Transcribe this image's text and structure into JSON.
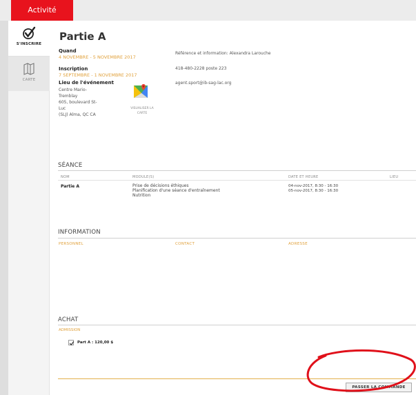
{
  "tabs": {
    "activite": "Activité"
  },
  "sidenav": {
    "inscrire": "S'INSCRIRE",
    "carte": "CARTE"
  },
  "event": {
    "title": "Partie A",
    "quand_label": "Quand",
    "quand_value": "4 NOVEMBRE - 5 NOVEMBRE 2017",
    "inscription_label": "Inscription",
    "inscription_value": "7 SEPTEMBRE - 1 NOVEMBRE 2017",
    "lieu_label": "Lieu de l'événement",
    "lieu_lines": [
      "Centre Mario-",
      "Tremblay",
      "605, boulevard St-",
      "Luc",
      "(SLJ) Alma, QC CA"
    ],
    "map_caption": "VISUALISER LA CARTE",
    "reference": "Référence et information: Alexandra Larouche",
    "phone": "418-480-2228 poste 223",
    "email": "agent.sport@ib-sag-lac.org"
  },
  "seance": {
    "title": "SÉANCE",
    "headers": {
      "nom": "NOM",
      "modules": "MODULE(S)",
      "date": "DATE ET HEURE",
      "lieu": "LIEU"
    },
    "row": {
      "nom": "Partie A",
      "modules": [
        "Prise de décisions éthiques",
        "Planification d'une séance d'entraînement",
        "Nutrition"
      ],
      "dates": [
        "04-nov-2017, 8:30 - 16:30",
        "05-nov-2017, 8:30 - 16:30"
      ]
    }
  },
  "information": {
    "title": "INFORMATION",
    "columns": {
      "personnel": "PERSONNEL",
      "contact": "CONTACT",
      "adresse": "ADRESSE"
    }
  },
  "achat": {
    "title": "ACHAT",
    "admission_label": "ADMISSION",
    "item_label": "Part A : 120,00 $",
    "item_checked": true
  },
  "actions": {
    "order_button": "PASSER LA COMMANDE"
  },
  "colors": {
    "accent_red": "#e8131d",
    "gold": "#e0a03a",
    "annotation": "#e0101a"
  }
}
